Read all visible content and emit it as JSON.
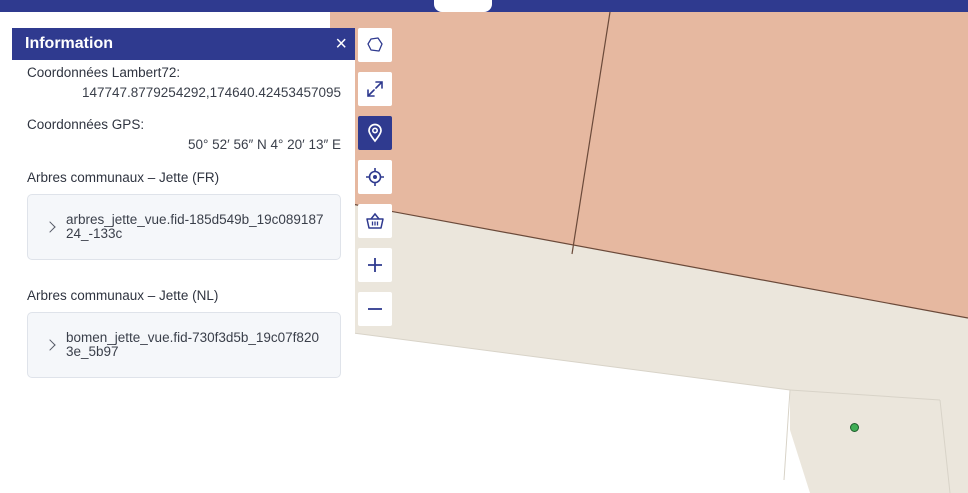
{
  "panel": {
    "title": "Information",
    "close_icon": "×",
    "lambert": {
      "label": "Coordonnées Lambert72:",
      "value": "147747.8779254292,174640.42453457095"
    },
    "gps": {
      "label": "Coordonnées GPS:",
      "value": "50° 52′ 56″ N 4° 20′ 13″ E"
    },
    "layers": [
      {
        "title": "Arbres communaux – Jette (FR)",
        "feature": "arbres_jette_vue.fid-185d549b_19c08918724_-133c"
      },
      {
        "title": "Arbres communaux – Jette (NL)",
        "feature": "bomen_jette_vue.fid-730f3d5b_19c07f8203e_5b97"
      }
    ]
  },
  "toolbar": {
    "buttons": [
      {
        "icon": "polygon-select-icon",
        "active": false
      },
      {
        "icon": "fullscreen-icon",
        "active": false
      },
      {
        "icon": "location-pin-icon",
        "active": true
      },
      {
        "icon": "geolocate-icon",
        "active": false
      },
      {
        "icon": "basket-icon",
        "active": false
      },
      {
        "icon": "zoom-in-icon",
        "active": false
      },
      {
        "icon": "zoom-out-icon",
        "active": false
      }
    ]
  },
  "colors": {
    "brand": "#2f3a8f",
    "parcel": "#e6b8a0",
    "road": "#ebe6dc",
    "marker": "#3fae55"
  }
}
